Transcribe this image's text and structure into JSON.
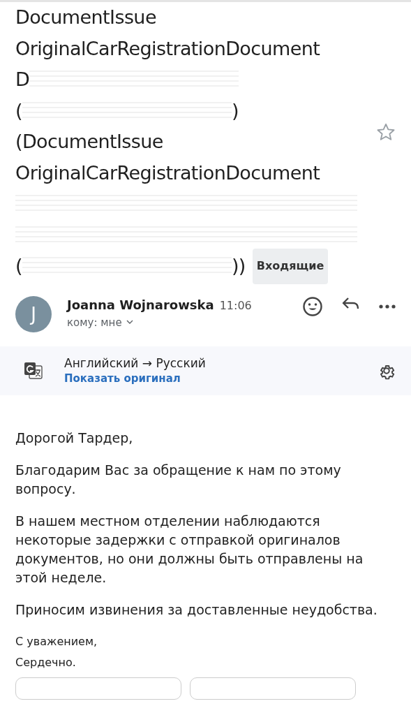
{
  "subject": {
    "lines": [
      {
        "kind": "text",
        "text": "DocumentIssue"
      },
      {
        "kind": "text",
        "text": "OriginalCarRegistrationDocument"
      },
      {
        "kind": "redacted",
        "before": "D"
      },
      {
        "kind": "redacted",
        "before": "(",
        "after": ")"
      },
      {
        "kind": "text",
        "text": "(DocumentIssue"
      },
      {
        "kind": "text",
        "text": "OriginalCarRegistrationDocument"
      },
      {
        "kind": "redacted"
      },
      {
        "kind": "redacted"
      },
      {
        "kind": "redacted",
        "before": "(",
        "after": "))"
      }
    ],
    "label": "Входящие",
    "starred": false
  },
  "message": {
    "sender": "Joanna Wojnarowska",
    "avatar_letter": "J",
    "time": "11:06",
    "recipient": "кому: мне"
  },
  "translation": {
    "languages": "Английский → Русский",
    "link": "Показать оригинал"
  },
  "body": [
    "Дорогой Тардер,",
    "Благодарим Вас за обращение к нам по этому вопросу.",
    "В нашем местном отделении наблюдаются некоторые задержки с отправкой оригиналов документов, но они должны быть отправлены на этой неделе.",
    "Приносим извинения за доставленные неудобства."
  ],
  "signature": [
    "С уважением,",
    "Сердечно."
  ]
}
